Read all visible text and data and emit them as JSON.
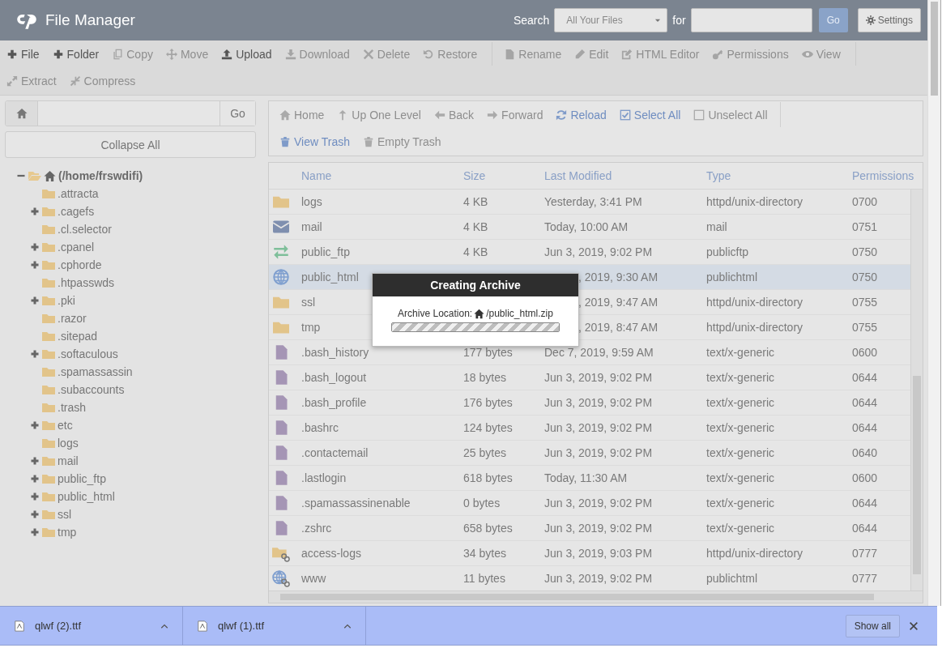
{
  "header": {
    "title": "File Manager",
    "search_label": "Search",
    "scope": "All Your Files",
    "for_label": "for",
    "go": "Go",
    "settings": "Settings"
  },
  "toolbar": [
    [
      {
        "label": "File",
        "disabled": false
      },
      {
        "label": "Folder",
        "disabled": false
      },
      {
        "label": "Copy",
        "disabled": true
      },
      {
        "label": "Move",
        "disabled": true
      },
      {
        "label": "Upload",
        "disabled": false
      },
      {
        "label": "Download",
        "disabled": true
      },
      {
        "label": "Delete",
        "disabled": true
      },
      {
        "label": "Restore",
        "disabled": true
      }
    ],
    [
      {
        "label": "Rename",
        "disabled": true
      },
      {
        "label": "Edit",
        "disabled": true
      },
      {
        "label": "HTML Editor",
        "disabled": true
      },
      {
        "label": "Permissions",
        "disabled": true
      },
      {
        "label": "View",
        "disabled": true
      }
    ],
    [
      {
        "label": "Extract",
        "disabled": true
      },
      {
        "label": "Compress",
        "disabled": true
      }
    ]
  ],
  "path_bar": {
    "go": "Go"
  },
  "collapse_all": "Collapse All",
  "tree": [
    {
      "label": "(/home/frswdifi)",
      "expanded": true,
      "children": [
        {
          "label": ".attracta",
          "expandable": false,
          "expanded": false
        },
        {
          "label": ".cagefs",
          "expandable": true,
          "expanded": false
        },
        {
          "label": ".cl.selector",
          "expandable": false,
          "expanded": false
        },
        {
          "label": ".cpanel",
          "expandable": true,
          "expanded": false
        },
        {
          "label": ".cphorde",
          "expandable": true,
          "expanded": false
        },
        {
          "label": ".htpasswds",
          "expandable": false,
          "expanded": false
        },
        {
          "label": ".pki",
          "expandable": true,
          "expanded": false
        },
        {
          "label": ".razor",
          "expandable": false,
          "expanded": false
        },
        {
          "label": ".sitepad",
          "expandable": false,
          "expanded": false
        },
        {
          "label": ".softaculous",
          "expandable": true,
          "expanded": false
        },
        {
          "label": ".spamassassin",
          "expandable": false,
          "expanded": false
        },
        {
          "label": ".subaccounts",
          "expandable": false,
          "expanded": false
        },
        {
          "label": ".trash",
          "expandable": false,
          "expanded": false
        },
        {
          "label": "etc",
          "expandable": true,
          "expanded": false
        },
        {
          "label": "logs",
          "expandable": false,
          "expanded": false
        },
        {
          "label": "mail",
          "expandable": true,
          "expanded": false
        },
        {
          "label": "public_ftp",
          "expandable": true,
          "expanded": false
        },
        {
          "label": "public_html",
          "expandable": true,
          "expanded": false
        },
        {
          "label": "ssl",
          "expandable": true,
          "expanded": false
        },
        {
          "label": "tmp",
          "expandable": true,
          "expanded": false
        }
      ]
    }
  ],
  "nav": [
    [
      {
        "label": "Home",
        "active": false
      },
      {
        "label": "Up One Level",
        "active": false
      },
      {
        "label": "Back",
        "active": false
      },
      {
        "label": "Forward",
        "active": false
      },
      {
        "label": "Reload",
        "active": true
      },
      {
        "label": "Select All",
        "active": true
      },
      {
        "label": "Unselect All",
        "active": false
      }
    ],
    [
      {
        "label": "View Trash",
        "active": true
      },
      {
        "label": "Empty Trash",
        "active": false
      }
    ]
  ],
  "table": {
    "columns": [
      "Name",
      "Size",
      "Last Modified",
      "Type",
      "Permissions"
    ],
    "rows": [
      {
        "kind": "folder",
        "name": "logs",
        "size": "4 KB",
        "modified": "Yesterday, 3:41 PM",
        "type": "httpd/unix-directory",
        "permissions": "0700",
        "selected": false,
        "covered": false
      },
      {
        "kind": "mail",
        "name": "mail",
        "size": "4 KB",
        "modified": "Today, 10:00 AM",
        "type": "mail",
        "permissions": "0751",
        "selected": false,
        "covered": false
      },
      {
        "kind": "ftp",
        "name": "public_ftp",
        "size": "4 KB",
        "modified": "Jun 3, 2019, 9:02 PM",
        "type": "publicftp",
        "permissions": "0750",
        "selected": false,
        "covered": false
      },
      {
        "kind": "web",
        "name": "public_html",
        "modified": ", 2019, 9:30 AM",
        "type": "publichtml",
        "permissions": "0750",
        "selected": true,
        "covered": true
      },
      {
        "kind": "folder",
        "name": "ssl",
        "modified": ", 2019, 9:47 AM",
        "type": "httpd/unix-directory",
        "permissions": "0755",
        "selected": false,
        "covered": true
      },
      {
        "kind": "folder",
        "name": "tmp",
        "modified": ", 2019, 8:47 AM",
        "type": "httpd/unix-directory",
        "permissions": "0755",
        "selected": false,
        "covered": true
      },
      {
        "kind": "file",
        "name": ".bash_history",
        "size": "177 bytes",
        "modified": "Dec 7, 2019, 9:59 AM",
        "type": "text/x-generic",
        "permissions": "0600",
        "selected": false,
        "covered": false
      },
      {
        "kind": "file",
        "name": ".bash_logout",
        "size": "18 bytes",
        "modified": "Jun 3, 2019, 9:02 PM",
        "type": "text/x-generic",
        "permissions": "0644",
        "selected": false,
        "covered": false
      },
      {
        "kind": "file",
        "name": ".bash_profile",
        "size": "176 bytes",
        "modified": "Jun 3, 2019, 9:02 PM",
        "type": "text/x-generic",
        "permissions": "0644",
        "selected": false,
        "covered": false
      },
      {
        "kind": "file",
        "name": ".bashrc",
        "size": "124 bytes",
        "modified": "Jun 3, 2019, 9:02 PM",
        "type": "text/x-generic",
        "permissions": "0644",
        "selected": false,
        "covered": false
      },
      {
        "kind": "file",
        "name": ".contactemail",
        "size": "25 bytes",
        "modified": "Jun 3, 2019, 9:02 PM",
        "type": "text/x-generic",
        "permissions": "0640",
        "selected": false,
        "covered": false
      },
      {
        "kind": "file",
        "name": ".lastlogin",
        "size": "618 bytes",
        "modified": "Today, 11:30 AM",
        "type": "text/x-generic",
        "permissions": "0600",
        "selected": false,
        "covered": false
      },
      {
        "kind": "file",
        "name": ".spamassassinenable",
        "size": "0 bytes",
        "modified": "Jun 3, 2019, 9:02 PM",
        "type": "text/x-generic",
        "permissions": "0644",
        "selected": false,
        "covered": false
      },
      {
        "kind": "file",
        "name": ".zshrc",
        "size": "658 bytes",
        "modified": "Jun 3, 2019, 9:02 PM",
        "type": "text/x-generic",
        "permissions": "0644",
        "selected": false,
        "covered": false
      },
      {
        "kind": "folder-link",
        "name": "access-logs",
        "size": "34 bytes",
        "modified": "Jun 3, 2019, 9:03 PM",
        "type": "httpd/unix-directory",
        "permissions": "0777",
        "selected": false,
        "covered": false
      },
      {
        "kind": "web-link",
        "name": "www",
        "size": "11 bytes",
        "modified": "Jun 3, 2019, 9:02 PM",
        "type": "publichtml",
        "permissions": "0777",
        "selected": false,
        "covered": false
      }
    ]
  },
  "dialog": {
    "title": "Creating Archive",
    "location_label": "Archive Location:",
    "location_path": "/public_html.zip",
    "level": 1
  },
  "downloads": {
    "items": [
      "qlwf (2).ttf",
      "qlwf (1).ttf"
    ],
    "show_all": "Show all"
  }
}
